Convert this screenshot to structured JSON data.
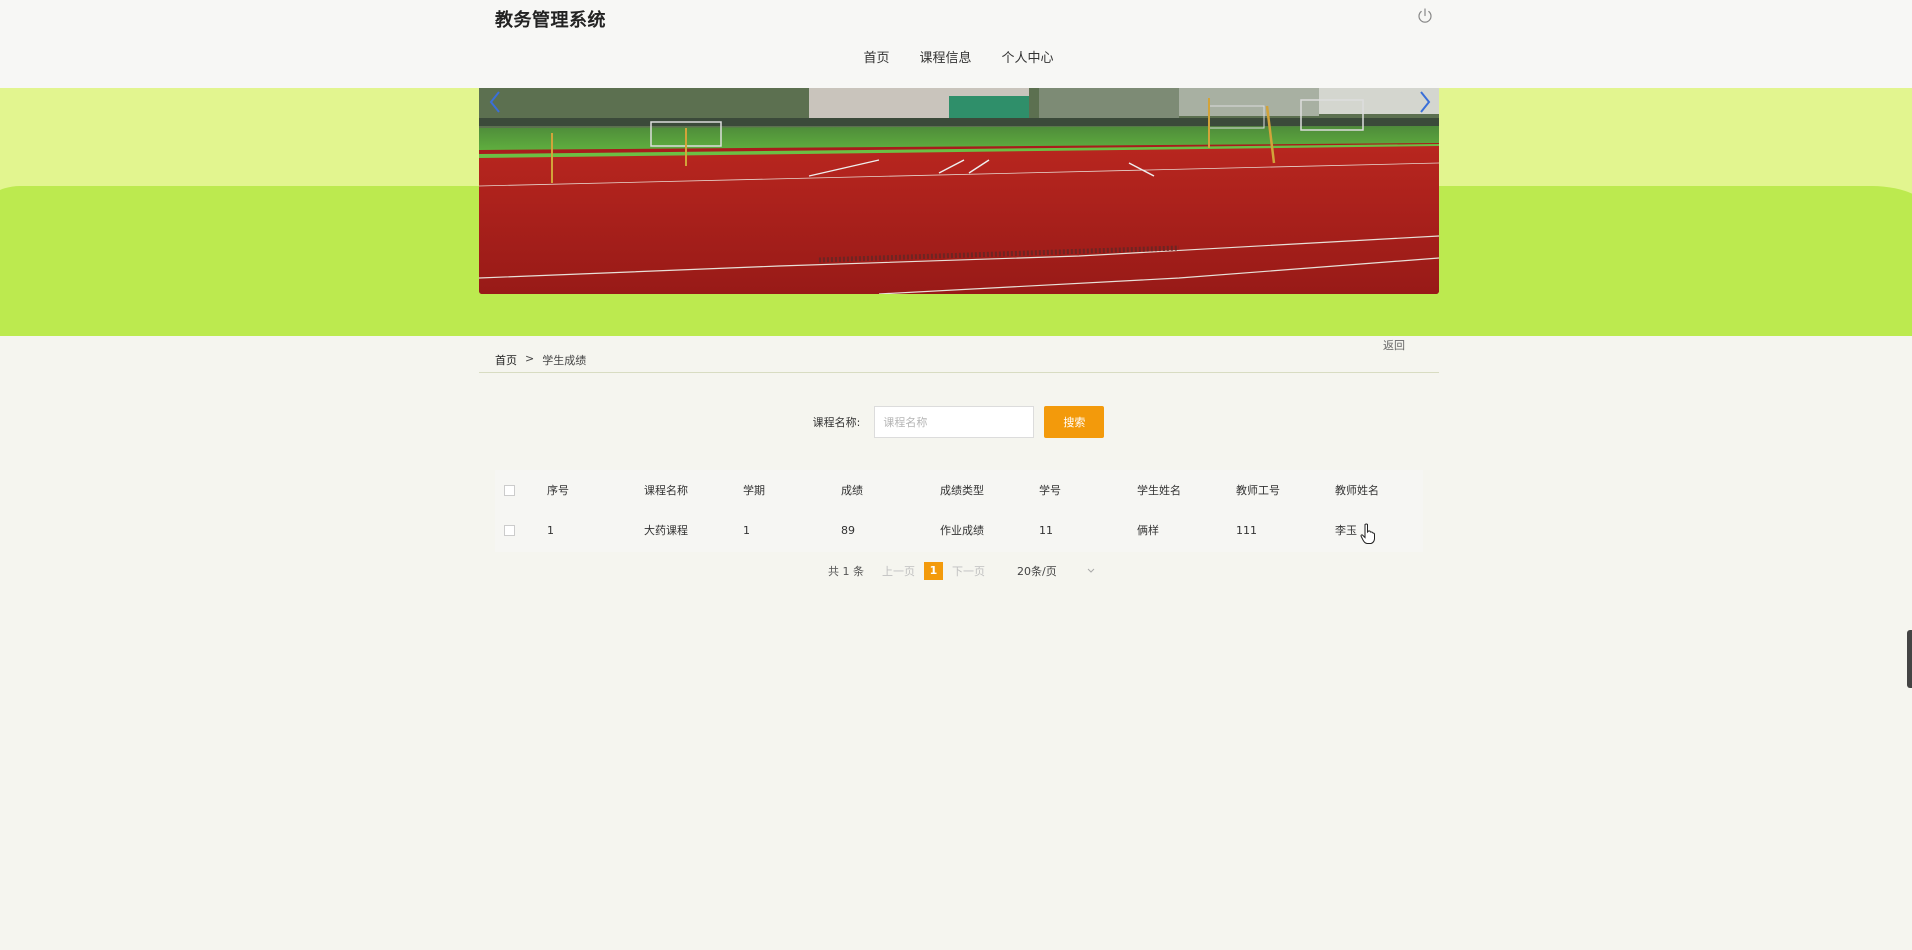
{
  "header": {
    "site_title": "教务管理系统",
    "power_icon": "power-icon"
  },
  "nav": {
    "items": [
      {
        "label": "首页"
      },
      {
        "label": "课程信息"
      },
      {
        "label": "个人中心"
      }
    ]
  },
  "banner": {
    "image": "sports-field-photo",
    "prev_icon": "chevron-left-icon",
    "next_icon": "chevron-right-icon"
  },
  "breadcrumb": {
    "home": "首页",
    "separator": ">",
    "current": "学生成绩",
    "back_label": "返回"
  },
  "search": {
    "label": "课程名称:",
    "placeholder": "课程名称",
    "value": "",
    "button_label": "搜索"
  },
  "table": {
    "columns": [
      "序号",
      "课程名称",
      "学期",
      "成绩",
      "成绩类型",
      "学号",
      "学生姓名",
      "教师工号",
      "教师姓名"
    ],
    "rows": [
      [
        "1",
        "大药课程",
        "1",
        "89",
        "作业成绩",
        "11",
        "俩样",
        "111",
        "李玉"
      ]
    ]
  },
  "pagination": {
    "total": "共 1 条",
    "prev": "上一页",
    "current_page": "1",
    "next": "下一页",
    "page_size": "20条/页"
  },
  "colors": {
    "accent": "#f39a0b",
    "banner_light": "#e2f58f",
    "banner_green": "#bcea4f"
  }
}
